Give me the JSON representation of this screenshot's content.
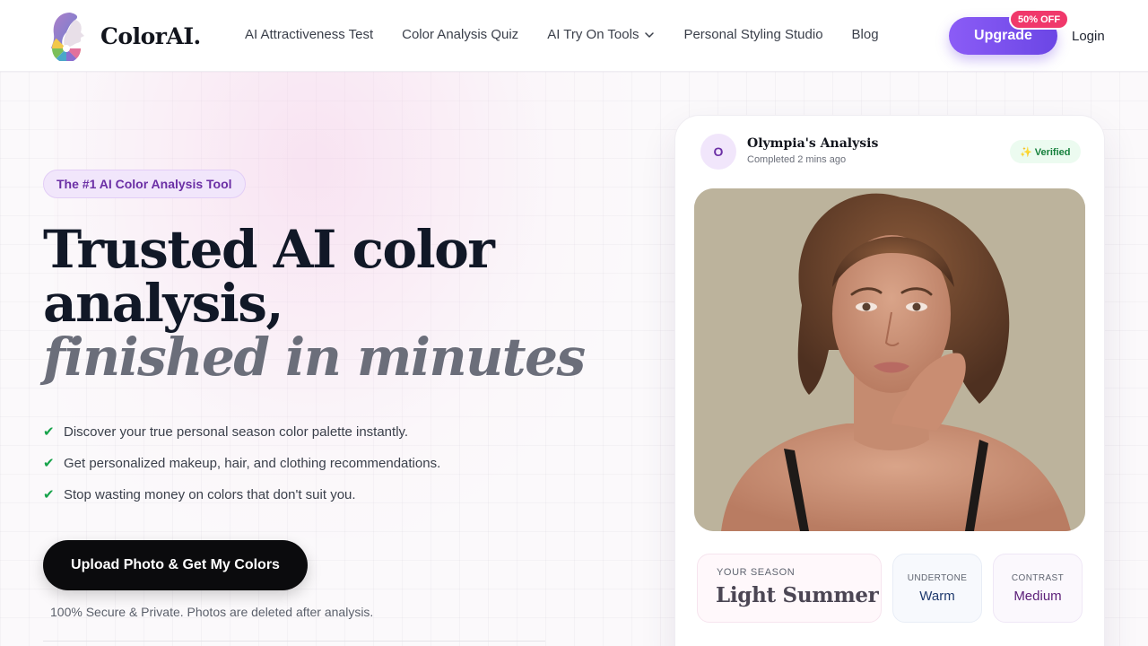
{
  "colors": {
    "accent": "#7c4dff",
    "promo_badge": "#f0386b",
    "cta": "#0b0b0d",
    "check": "#16a34a"
  },
  "header": {
    "brand": "ColorAI.",
    "logo_icon": "woman-profile-color-wheel-icon",
    "nav": [
      {
        "label": "AI Attractiveness Test"
      },
      {
        "label": "Color Analysis Quiz"
      },
      {
        "label": "AI Try On Tools",
        "icon": "chevron-down-icon"
      },
      {
        "label": "Personal Styling Studio"
      },
      {
        "label": "Blog"
      }
    ],
    "upgrade_label": "Upgrade",
    "promo_badge": "50% OFF",
    "login_label": "Login"
  },
  "hero": {
    "tag": "The #1 AI Color Analysis Tool",
    "headline_line1": "Trusted AI color",
    "headline_line2": "analysis,",
    "headline_line3": "finished in minutes",
    "bullets": [
      "Discover your true personal season color palette instantly.",
      "Get personalized makeup, hair, and clothing recommendations.",
      "Stop wasting money on colors that don't suit you."
    ],
    "bullet_icon": "check-icon",
    "cta_label": "Upload Photo & Get My Colors",
    "secure_note": "100% Secure & Private. Photos are deleted after analysis."
  },
  "card": {
    "avatar_initial": "O",
    "title": "Olympia's Analysis",
    "subtitle": "Completed 2 mins ago",
    "verified": "✨ Verified",
    "photo": "portrait-photo",
    "season_label": "YOUR SEASON",
    "season_value": "Light Summer",
    "undertone_label": "UNDERTONE",
    "undertone_value": "Warm",
    "contrast_label": "CONTRAST",
    "contrast_value": "Medium"
  }
}
